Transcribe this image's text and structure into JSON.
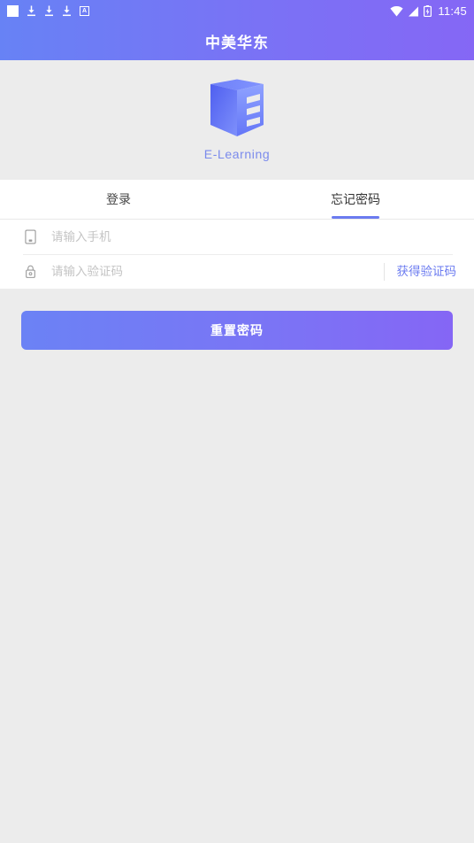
{
  "status_bar": {
    "time": "11:45",
    "left_icons": [
      "app-square-icon",
      "download-icon",
      "download-icon",
      "download-icon",
      "font-a-icon"
    ],
    "right_icons": [
      "wifi-icon",
      "signal-icon",
      "battery-icon"
    ],
    "font_badge_label": "A"
  },
  "app_bar": {
    "title": "中美华东"
  },
  "logo": {
    "caption": "E-Learning",
    "mark": "e-learning-cube-logo"
  },
  "tabs": [
    {
      "label": "登录",
      "active": false
    },
    {
      "label": "忘记密码",
      "active": true
    }
  ],
  "form": {
    "fields": [
      {
        "icon": "phone-icon",
        "placeholder": "请输入手机",
        "value": "",
        "action_label": null
      },
      {
        "icon": "lock-icon",
        "placeholder": "请输入验证码",
        "value": "",
        "action_label": "获得验证码"
      }
    ]
  },
  "submit": {
    "label": "重置密码"
  },
  "colors": {
    "brand_start": "#6782f5",
    "brand_end": "#8567f5",
    "accent": "#6b7bf0",
    "background": "#ececec",
    "surface": "#ffffff",
    "placeholder": "#c4c4c4"
  }
}
